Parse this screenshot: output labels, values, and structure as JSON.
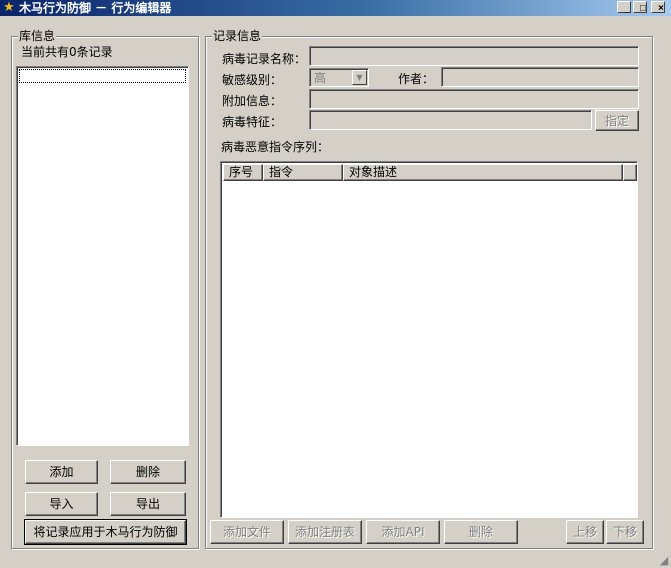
{
  "window": {
    "title": "木马行为防御 － 行为编辑器",
    "minimize_glyph": "_",
    "maximize_glyph": "□",
    "close_glyph": "×"
  },
  "library": {
    "legend": "库信息",
    "count_text": "当前共有0条记录",
    "buttons": {
      "add": "添加",
      "delete": "删除",
      "import": "导入",
      "export": "导出",
      "apply": "将记录应用于木马行为防御"
    }
  },
  "record": {
    "legend": "记录信息",
    "name_label": "病毒记录名称：",
    "name_value": "",
    "level_label": "敏感级别：",
    "level_value": "高",
    "author_label": "作者：",
    "author_value": "",
    "extra_label": "附加信息：",
    "extra_value": "",
    "signature_label": "病毒特征：",
    "signature_value": "",
    "assign_button": "指定",
    "sequence_label": "病毒恶意指令序列：",
    "columns": [
      "序号",
      "指令",
      "对象描述"
    ],
    "rows": []
  },
  "actions": {
    "add_file": "添加文件",
    "add_registry": "添加注册表",
    "add_api": "添加API",
    "delete": "删除",
    "move_up": "上移",
    "move_down": "下移"
  }
}
